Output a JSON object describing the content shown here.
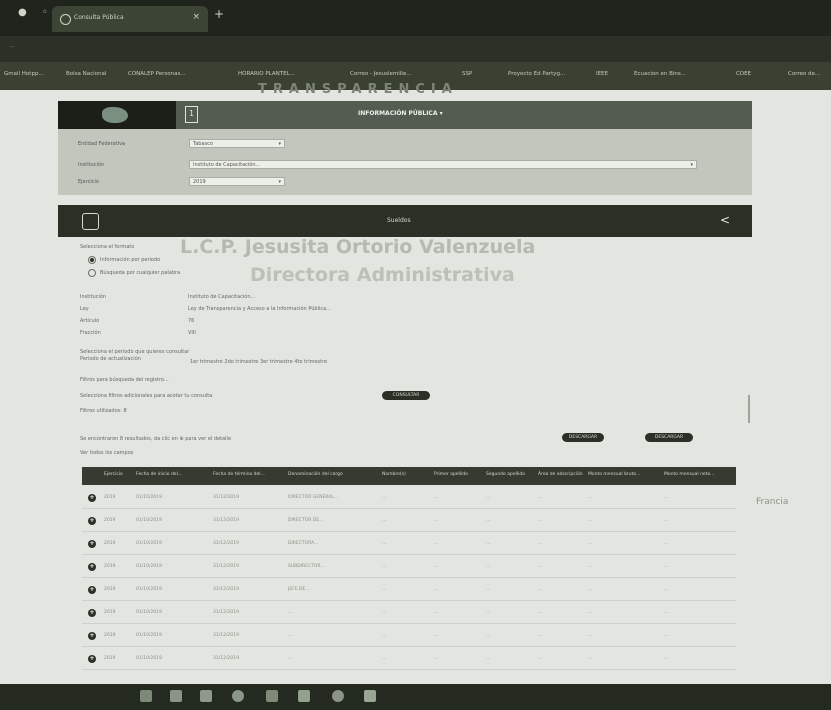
{
  "browser": {
    "tab_title": "Consulta Pública",
    "url": "...",
    "bookmarks": [
      "Gmail Hotpp...",
      "Bolsa Nacional",
      "CONALEP Personas...",
      "HORARIO PLANTEL...",
      "Correo - Jesuslemille...",
      "SSP",
      "Proyecto Ed Partyg...",
      "IEEE",
      "Ecuacion en Bins...",
      "CDEE",
      "Correo de..."
    ]
  },
  "header": {
    "faded_title": "TRANSPARENCIA",
    "menu_label": "INFORMACIÓN PÚBLICA ▾"
  },
  "filters": {
    "rows": [
      {
        "label": "Entidad Federativa",
        "value": "Tabasco"
      },
      {
        "label": "Institución",
        "value": "Instituto de Capacitación..."
      },
      {
        "label": "Ejercicio",
        "value": "2019"
      }
    ]
  },
  "subbar": {
    "label": "Sueldos"
  },
  "watermark": {
    "line1": "L.C.P. Jesusita Ortorio Valenzuela",
    "line2": "Directora Administrativa",
    "side": "Francia"
  },
  "body": {
    "section_label": "Selecciona el formato",
    "radio_1": "Información por periodo",
    "radio_2": "Búsqueda por cualquier palabra",
    "meta": [
      {
        "label": "Institución",
        "value": "Instituto de Capacitación..."
      },
      {
        "label": "Ley",
        "value": "Ley de Transparencia y Acceso a la Información Pública..."
      },
      {
        "label": "Artículo",
        "value": "76"
      },
      {
        "label": "Fracción",
        "value": "VIII"
      }
    ],
    "period_label": "Selecciona el periodo que quieres consultar",
    "period_sublabel": "Periodo de actualización",
    "period_options": "1er trimestre   2do trimestre   3er trimestre   4to trimestre",
    "filter_line1": "Filtros para búsqueda del registro...",
    "filter_line2": "Selecciona filtros adicionales para acotar tu consulta",
    "consult_button": "CONSULTAR",
    "filters_applied": "Filtros utilizados: 8",
    "results_line": "Se encontraron 8 resultados, da clic en ⊕ para ver el detalle",
    "show_fields": "Ver todos los campos",
    "download_1": "DESCARGAR",
    "download_2": "DESCARGAR"
  },
  "table": {
    "headers": [
      "Ejercicio",
      "Fecha de inicio del...",
      "Fecha de término del...",
      "Denominación del cargo",
      "Nombre(s)",
      "Primer apellido",
      "Segundo apellido",
      "Área de adscripción",
      "Monto mensual bruto...",
      "Monto mensual neto..."
    ],
    "rows": [
      [
        "2019",
        "01/10/2019",
        "31/12/2019",
        "DIRECTOR GENERAL...",
        "...",
        "...",
        "...",
        "...",
        "...",
        "..."
      ],
      [
        "2019",
        "01/10/2019",
        "31/12/2019",
        "DIRECTOR DE...",
        "...",
        "...",
        "...",
        "...",
        "...",
        "..."
      ],
      [
        "2019",
        "01/10/2019",
        "31/12/2019",
        "DIRECTORA...",
        "...",
        "...",
        "...",
        "...",
        "...",
        "..."
      ],
      [
        "2019",
        "01/10/2019",
        "31/12/2019",
        "SUBDIRECTOR...",
        "...",
        "...",
        "...",
        "...",
        "...",
        "..."
      ],
      [
        "2019",
        "01/10/2019",
        "31/12/2019",
        "JEFE DE...",
        "...",
        "...",
        "...",
        "...",
        "...",
        "..."
      ],
      [
        "2019",
        "01/10/2019",
        "31/12/2019",
        "...",
        "...",
        "...",
        "...",
        "...",
        "...",
        "..."
      ],
      [
        "2019",
        "01/10/2019",
        "31/12/2019",
        "...",
        "...",
        "...",
        "...",
        "...",
        "...",
        "..."
      ],
      [
        "2019",
        "01/10/2019",
        "31/12/2019",
        "...",
        "...",
        "...",
        "...",
        "...",
        "...",
        "..."
      ]
    ]
  },
  "taskbar": {
    "icons": [
      "windows-icon",
      "mail-icon",
      "files-icon",
      "browser-icon",
      "store-icon",
      "photos-icon",
      "settings-icon",
      "app-icon"
    ]
  }
}
